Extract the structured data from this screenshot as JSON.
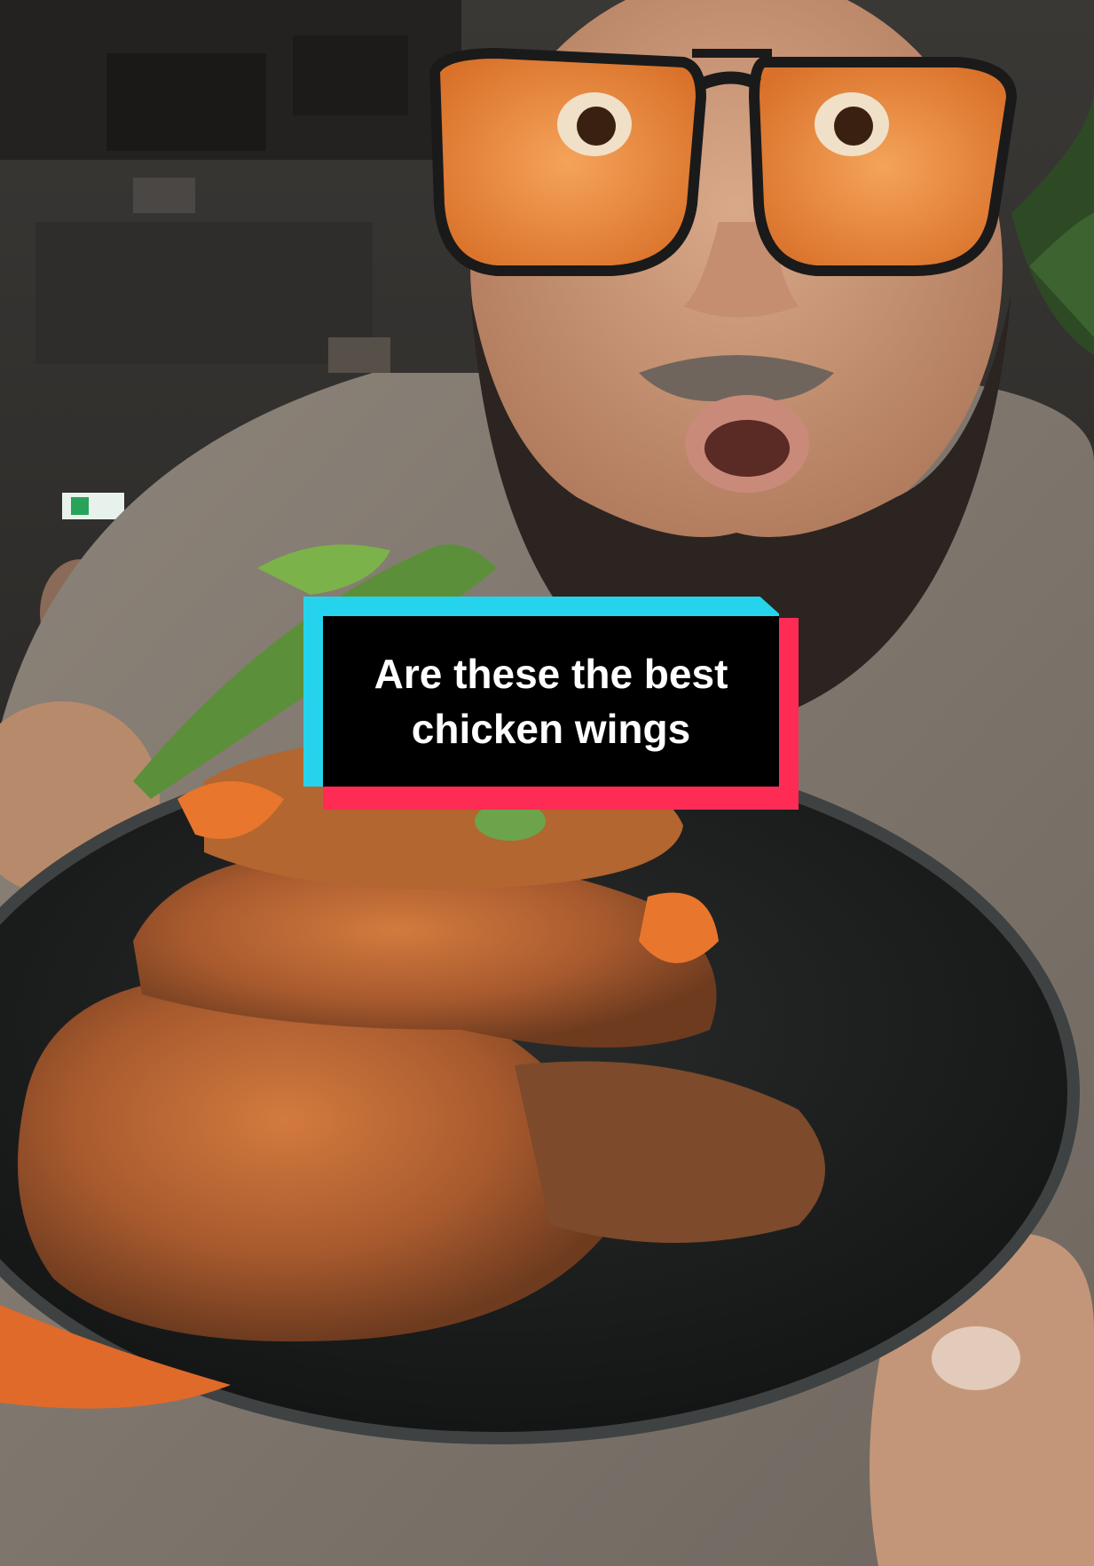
{
  "caption": {
    "line1": "Are these the best",
    "line2": "chicken wings"
  },
  "colors": {
    "caption_bg": "#000000",
    "caption_text": "#ffffff",
    "accent_cyan": "#25d4ec",
    "accent_red": "#fe2c55"
  }
}
